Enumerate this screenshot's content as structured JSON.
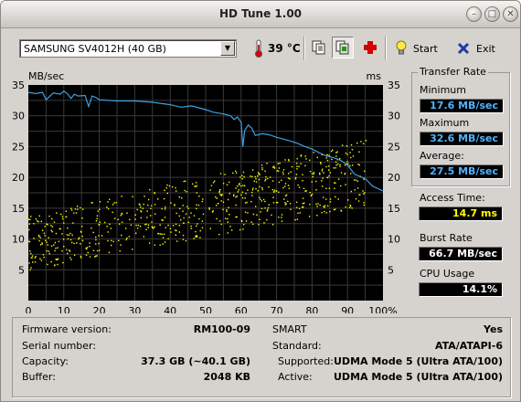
{
  "window": {
    "title": "HD Tune 1.00",
    "buttons": {
      "minimize": "–",
      "maximize": "□",
      "close": "✕"
    }
  },
  "toolbar": {
    "drive_select": "SAMSUNG SV4012H (40 GB)",
    "temperature": "39 °C",
    "start_label": "Start",
    "exit_label": "Exit"
  },
  "chart_data": {
    "type": "line",
    "left_axis_label": "MB/sec",
    "right_axis_label": "ms",
    "y_ticks": [
      35,
      30,
      25,
      20,
      15,
      10,
      5
    ],
    "right_ticks": [
      "35",
      "30",
      "25",
      "20",
      "15",
      "10",
      "5"
    ],
    "x_ticks": [
      "0",
      "10",
      "20",
      "30",
      "40",
      "50",
      "60",
      "70",
      "80",
      "90",
      "100%"
    ],
    "xlim": [
      0,
      100
    ],
    "ylim": [
      0,
      35
    ],
    "grid": true,
    "colors": {
      "background": "#000000",
      "grid": "#3a3a3a",
      "transfer": "#3ea0e0",
      "access": "#ffff00"
    },
    "series": [
      {
        "type": "line",
        "x": [
          0,
          2,
          4,
          5,
          7,
          9,
          10,
          11,
          12,
          13,
          14,
          16,
          17,
          18,
          19,
          20,
          25,
          30,
          35,
          40,
          43,
          46,
          50,
          52,
          55,
          57,
          58,
          59,
          60,
          60.5,
          61,
          62,
          63,
          64,
          66,
          68,
          70,
          72,
          74,
          76,
          78,
          80,
          82,
          84,
          86,
          88,
          90,
          92,
          95,
          97,
          100
        ],
        "values": [
          33.8,
          33.6,
          33.8,
          32.6,
          33.7,
          33.5,
          34.0,
          33.6,
          32.8,
          33.5,
          33.2,
          33.3,
          31.5,
          33.2,
          33.0,
          32.6,
          32.4,
          32.4,
          32.2,
          31.8,
          31.4,
          31.6,
          31.0,
          30.6,
          30.3,
          30.0,
          29.4,
          29.8,
          28.9,
          25.0,
          27.6,
          28.5,
          28.0,
          26.8,
          27.1,
          26.9,
          26.5,
          26.2,
          25.9,
          25.5,
          25.0,
          24.6,
          24.0,
          23.5,
          23.2,
          22.8,
          22.0,
          20.5,
          19.8,
          18.6,
          17.8
        ]
      },
      {
        "type": "scatter",
        "x_range": [
          0,
          95
        ],
        "min_floor": [
          5,
          15.8
        ],
        "spread": [
          9,
          11
        ],
        "note": "access time points (ms)"
      }
    ]
  },
  "transfer_rate": {
    "title": "Transfer Rate",
    "minimum_label": "Minimum",
    "minimum": "17.6 MB/sec",
    "maximum_label": "Maximum",
    "maximum": "32.6 MB/sec",
    "average_label": "Average:",
    "average": "27.5 MB/sec"
  },
  "access_time": {
    "label": "Access Time:",
    "value": "14.7 ms"
  },
  "burst_rate": {
    "label": "Burst Rate",
    "value": "66.7 MB/sec"
  },
  "cpu_usage": {
    "label": "CPU Usage",
    "value": "14.1%"
  },
  "info": {
    "firmware_label": "Firmware version:",
    "firmware": "RM100-09",
    "serial_label": "Serial number:",
    "serial": "",
    "capacity_label": "Capacity:",
    "capacity": "37.3 GB (~40.1 GB)",
    "buffer_label": "Buffer:",
    "buffer": "2048 KB",
    "smart_label": "SMART",
    "smart": "Yes",
    "standard_label": "Standard:",
    "standard": "ATA/ATAPI-6",
    "supported_label": "Supported:",
    "supported": "UDMA Mode 5 (Ultra ATA/100)",
    "active_label": "Active:",
    "active": "UDMA Mode 5 (Ultra ATA/100)"
  }
}
